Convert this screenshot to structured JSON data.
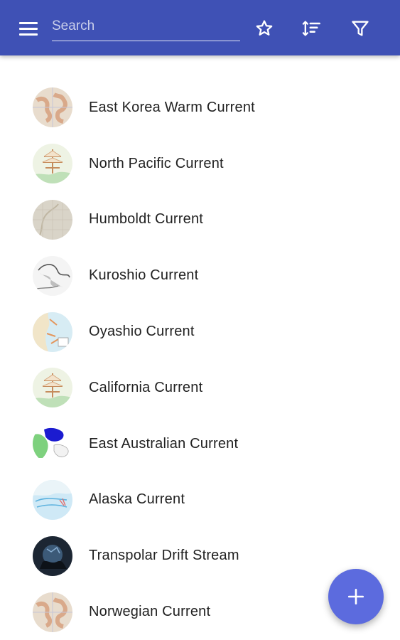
{
  "toolbar": {
    "search_placeholder": "Search",
    "menu_icon": "menu-icon",
    "favorite_icon": "star-outline-icon",
    "sort_icon": "sort-icon",
    "filter_icon": "filter-icon",
    "bar_color": "#3f51b5"
  },
  "items": [
    {
      "label": "East Korea Warm Current",
      "thumb": "world-map-thumbnail"
    },
    {
      "label": "North Pacific Current",
      "thumb": "sailing-ship-map-thumbnail"
    },
    {
      "label": "Humboldt Current",
      "thumb": "old-map-thumbnail"
    },
    {
      "label": "Kuroshio Current",
      "thumb": "grey-sketch-map-thumbnail"
    },
    {
      "label": "Oyashio Current",
      "thumb": "coastal-map-thumbnail"
    },
    {
      "label": "California Current",
      "thumb": "sailing-ship-map-thumbnail"
    },
    {
      "label": "East Australian Current",
      "thumb": "australia-map-thumbnail"
    },
    {
      "label": "Alaska Current",
      "thumb": "blue-ocean-map-thumbnail"
    },
    {
      "label": "Transpolar Drift Stream",
      "thumb": "dark-polar-photo-thumbnail"
    },
    {
      "label": "Norwegian Current",
      "thumb": "world-map-thumbnail"
    }
  ],
  "fab": {
    "icon": "plus-icon",
    "color": "#5c6bde"
  }
}
